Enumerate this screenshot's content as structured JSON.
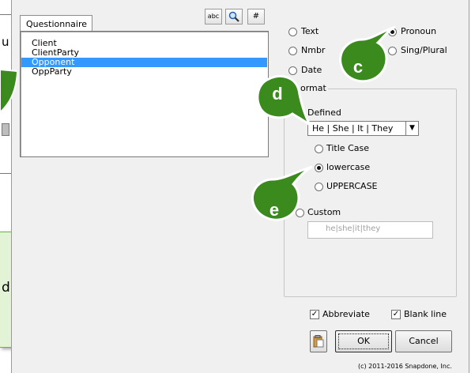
{
  "questionnaire": {
    "tab_label": "Questionnaire",
    "items": [
      {
        "label": "Client"
      },
      {
        "label": "ClientParty"
      },
      {
        "label": "Opponent"
      },
      {
        "label": "OppParty"
      }
    ],
    "selected_index": 2
  },
  "toolbar": {
    "abc_label": "abc",
    "search_icon": "magnifier-icon",
    "number_label": "#"
  },
  "type_options": {
    "text": "Text",
    "nmbr": "Nmbr",
    "date": "Date",
    "pronoun": "Pronoun",
    "sing_plural": "Sing/Plural",
    "selected": "pronoun"
  },
  "format": {
    "group_label": "ormat",
    "defined_label": "Defined",
    "defined_value": "He | She | It | They",
    "title_case": "Title Case",
    "lowercase": "lowercase",
    "uppercase": "UPPERCASE",
    "custom_label": "Custom",
    "custom_placeholder": "he|she|it|they",
    "case_selected": "lowercase"
  },
  "options": {
    "abbreviate": "Abbreviate",
    "abbreviate_checked": true,
    "blank_line": "Blank line",
    "blank_line_checked": true
  },
  "buttons": {
    "ok": "OK",
    "cancel": "Cancel",
    "paste_icon": "clipboard-icon"
  },
  "copyright": "(c) 2011-2016 Snapdone, Inc.",
  "left_fragments": {
    "top": "u",
    "bottom": "d"
  },
  "callouts": {
    "c": "c",
    "d": "d",
    "e": "e",
    "color": "#3a8a1e"
  }
}
